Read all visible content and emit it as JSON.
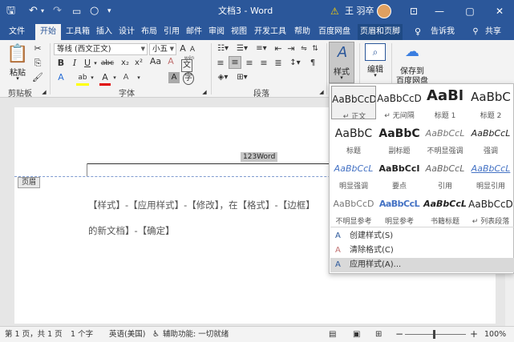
{
  "titlebar": {
    "doc_title": "文档3 - Word",
    "user_name": "王 羽卒",
    "warning_icon": "warning-icon",
    "save_icon": "save-icon",
    "undo_icon": "undo-icon",
    "redo_icon": "redo-icon",
    "minimize": "—",
    "restore": "▢",
    "close": "✕",
    "ribbon_options": "⊡"
  },
  "tabs": [
    "文件",
    "开始",
    "工具箱",
    "插入",
    "设计",
    "布局",
    "引用",
    "邮件",
    "审阅",
    "视图",
    "开发工具",
    "帮助",
    "百度网盘",
    "页眉和页脚",
    "告诉我",
    "共享"
  ],
  "ribbon": {
    "clipboard": {
      "paste": "粘贴",
      "label": "剪贴板"
    },
    "font": {
      "font_name": "等线 (西文正文)",
      "font_size": "小五",
      "label": "字体",
      "grow": "A",
      "shrink": "A",
      "aa": "Aa",
      "clear": "A",
      "wen": "wén",
      "a_box": "A",
      "bold": "B",
      "italic": "I",
      "underline": "U",
      "strike": "abc",
      "sub": "x₂",
      "sup": "x²",
      "effects": "A",
      "highlight": "ab",
      "color": "A",
      "char_shade": "A",
      "circle": "字"
    },
    "paragraph": {
      "label": "段落"
    },
    "styles": {
      "label": "样式"
    },
    "editing": {
      "label": "编辑"
    },
    "baidu": {
      "line1": "保存到",
      "line2": "百度网盘"
    }
  },
  "document": {
    "header_text": "123Word",
    "header_tag": "页眉",
    "line1": "【样式】-【应用样式】-【修改】，在【格式】-【边框】",
    "line2": "的新文档】-【确定】"
  },
  "styles_gallery": {
    "items": [
      {
        "preview": "AaBbCcD",
        "name": "↵ 正文"
      },
      {
        "preview": "AaBbCcD",
        "name": "↵ 无间隔"
      },
      {
        "preview": "AaBl",
        "name": "标题 1"
      },
      {
        "preview": "AaBbC",
        "name": "标题 2"
      },
      {
        "preview": "AaBbC",
        "name": "标题"
      },
      {
        "preview": "AaBbC",
        "name": "副标题"
      },
      {
        "preview": "AaBbCcL",
        "name": "不明显强调"
      },
      {
        "preview": "AaBbCcL",
        "name": "强调"
      },
      {
        "preview": "AaBbCcL",
        "name": "明显强调"
      },
      {
        "preview": "AaBbCcI",
        "name": "要点"
      },
      {
        "preview": "AaBbCcL",
        "name": "引用"
      },
      {
        "preview": "AaBbCcL",
        "name": "明显引用"
      },
      {
        "preview": "AaBbCcD",
        "name": "不明显参考"
      },
      {
        "preview": "AaBbCcL",
        "name": "明显参考"
      },
      {
        "preview": "AaBbCcL",
        "name": "书籍标题"
      },
      {
        "preview": "AaBbCcD",
        "name": "↵ 列表段落"
      }
    ],
    "menu": [
      {
        "label": "创建样式(S)"
      },
      {
        "label": "清除格式(C)"
      },
      {
        "label": "应用样式(A)..."
      }
    ]
  },
  "statusbar": {
    "page": "第 1 页，共 1 页",
    "words": "1 个字",
    "language": "英语(美国)",
    "accessibility": "辅助功能: 一切就绪",
    "zoom": "100%",
    "zoom_minus": "−",
    "zoom_plus": "+"
  },
  "colors": {
    "word_blue": "#2b579a",
    "highlight_yellow": "#ffff00",
    "font_red": "#e00000"
  }
}
